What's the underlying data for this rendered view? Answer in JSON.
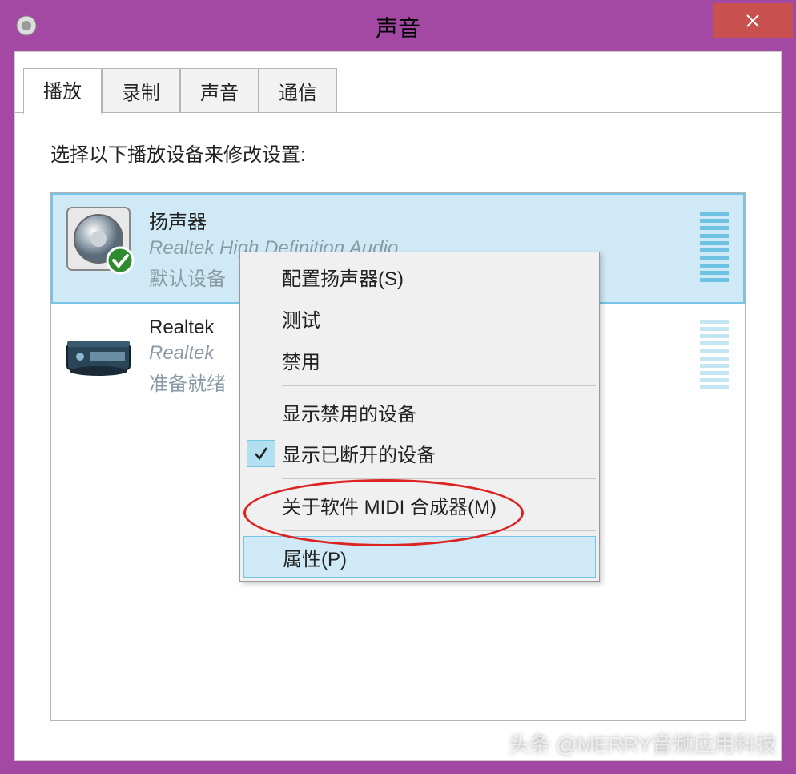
{
  "window": {
    "title": "声音",
    "close_icon": "close-icon"
  },
  "tabs": [
    {
      "label": "播放",
      "active": true
    },
    {
      "label": "录制",
      "active": false
    },
    {
      "label": "声音",
      "active": false
    },
    {
      "label": "通信",
      "active": false
    }
  ],
  "instruction": "选择以下播放设备来修改设置:",
  "devices": [
    {
      "name": "扬声器",
      "sub": "Realtek High Definition Audio",
      "status": "默认设备",
      "selected": true,
      "default_badge": true,
      "icon": "speaker"
    },
    {
      "name": "Realtek",
      "sub": "Realtek",
      "status": "准备就绪",
      "selected": false,
      "default_badge": false,
      "icon": "receiver"
    }
  ],
  "context_menu": {
    "items": [
      {
        "label": "配置扬声器(S)",
        "checked": false,
        "group": 1
      },
      {
        "label": "测试",
        "checked": false,
        "group": 1
      },
      {
        "label": "禁用",
        "checked": false,
        "group": 1
      },
      {
        "label": "显示禁用的设备",
        "checked": false,
        "group": 2
      },
      {
        "label": "显示已断开的设备",
        "checked": true,
        "group": 2
      },
      {
        "label": "关于软件 MIDI 合成器(M)",
        "checked": false,
        "group": 3
      },
      {
        "label": "属性(P)",
        "checked": false,
        "group": 4,
        "hover": true
      }
    ]
  },
  "watermark": "头条 @MERRY音频应用科技",
  "colors": {
    "accent": "#a349a4",
    "selection": "#cfeaf6",
    "selection_border": "#77c5e6",
    "close": "#c8504f"
  }
}
